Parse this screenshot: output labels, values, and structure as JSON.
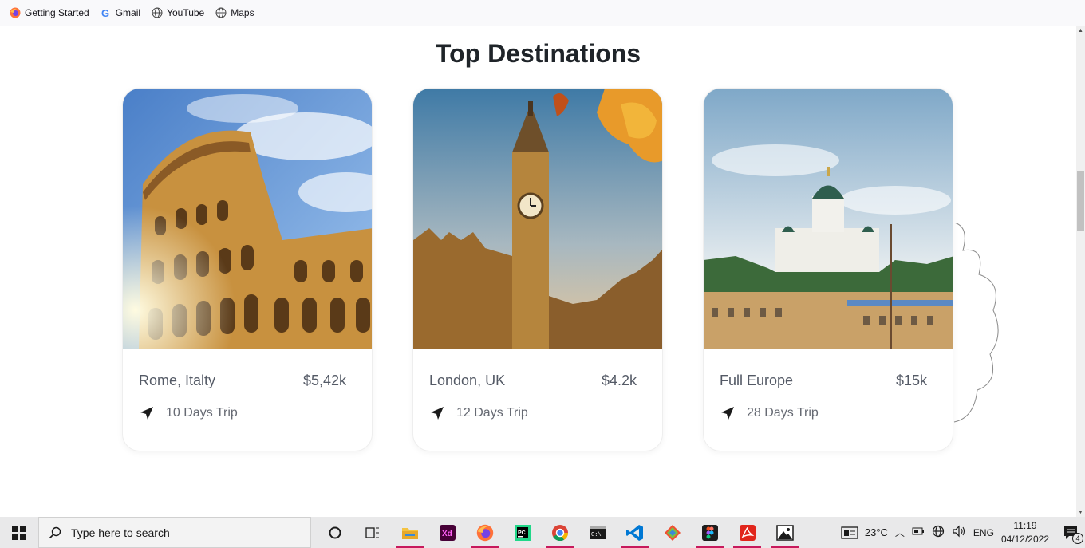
{
  "bookmarks": [
    {
      "label": "Getting Started",
      "icon": "firefox-icon"
    },
    {
      "label": "Gmail",
      "icon": "google-icon"
    },
    {
      "label": "YouTube",
      "icon": "globe-icon"
    },
    {
      "label": "Maps",
      "icon": "globe-icon"
    }
  ],
  "section": {
    "title": "Top Destinations"
  },
  "cards": [
    {
      "place": "Rome, Italty",
      "price": "$5,42k",
      "duration": "10 Days Trip",
      "image": "colosseum-photo"
    },
    {
      "place": "London, UK",
      "price": "$4.2k",
      "duration": "12 Days Trip",
      "image": "big-ben-photo"
    },
    {
      "place": "Full Europe",
      "price": "$15k",
      "duration": "28 Days Trip",
      "image": "helsinki-cathedral-photo"
    }
  ],
  "taskbar": {
    "search_placeholder": "Type here to search",
    "weather": "23°C",
    "language": "ENG",
    "time": "11:19",
    "date": "04/12/2022",
    "notifications": "4"
  },
  "colors": {
    "accent": "#c7195c",
    "title": "#1f2429"
  }
}
